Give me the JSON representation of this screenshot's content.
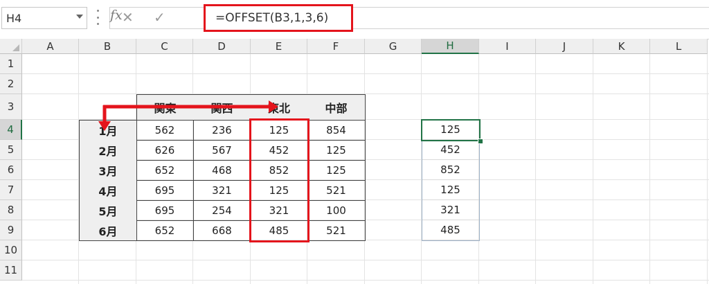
{
  "name_box": {
    "value": "H4"
  },
  "formula_bar": {
    "fx": "fx",
    "formula": "=OFFSET(B3,1,3,6)"
  },
  "columns": [
    "A",
    "B",
    "C",
    "D",
    "E",
    "F",
    "G",
    "H",
    "I",
    "J",
    "K",
    "L"
  ],
  "rows": [
    "1",
    "2",
    "3",
    "4",
    "5",
    "6",
    "7",
    "8",
    "9",
    "10",
    "11"
  ],
  "active_cell": "H4",
  "table": {
    "headers": [
      "関東",
      "関西",
      "東北",
      "中部"
    ],
    "row_labels": [
      "1月",
      "2月",
      "3月",
      "4月",
      "5月",
      "6月"
    ],
    "values": [
      [
        "562",
        "236",
        "125",
        "854"
      ],
      [
        "626",
        "567",
        "452",
        "125"
      ],
      [
        "652",
        "468",
        "852",
        "125"
      ],
      [
        "695",
        "321",
        "125",
        "521"
      ],
      [
        "695",
        "254",
        "321",
        "100"
      ],
      [
        "652",
        "668",
        "485",
        "521"
      ]
    ]
  },
  "result_column": [
    "125",
    "452",
    "852",
    "125",
    "321",
    "485"
  ],
  "colors": {
    "highlight": "#e4141c",
    "selection": "#217346",
    "header_fill": "#efefef"
  }
}
